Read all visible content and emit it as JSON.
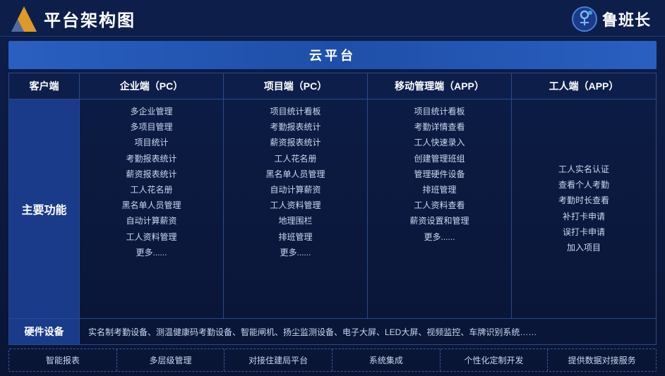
{
  "header": {
    "title": "平台架构图",
    "logo_name": "鲁班长"
  },
  "cloud_platform": "云平台",
  "columns": {
    "client": "客户端",
    "enterprise": "企业端（PC）",
    "project_pc": "项目端（PC）",
    "mobile_mgmt": "移动管理端（APP）",
    "worker": "工人端（APP）"
  },
  "main_function_label": "主要功能",
  "enterprise_items": [
    "多企业管理",
    "多项目管理",
    "项目统计",
    "考勤报表统计",
    "薪资报表统计",
    "工人花名册",
    "黑名单人员管理",
    "自动计算薪资",
    "工人资料管理",
    "更多......"
  ],
  "project_pc_items": [
    "项目统计看板",
    "考勤报表统计",
    "薪资报表统计",
    "工人花名册",
    "黑名单人员管理",
    "自动计算薪资",
    "工人资料管理",
    "地理围栏",
    "排班管理",
    "更多......"
  ],
  "mobile_mgmt_items": [
    "项目统计看板",
    "考勤详情查看",
    "工人快速录入",
    "创建管理班组",
    "管理硬件设备",
    "排班管理",
    "工人资料查看",
    "薪资设置和管理",
    "更多......"
  ],
  "worker_items": [
    "工人实名认证",
    "查看个人考勤",
    "考勤时长查看",
    "补打卡申请",
    "误打卡申请",
    "加入项目"
  ],
  "hardware_label": "硬件设备",
  "hardware_content": "实名制考勤设备、测温健康码考勤设备、智能闸机、扬尘监测设备、电子大屏、LED大屏、视频监控、车牌识别系统……",
  "bottom_features": [
    "智能报表",
    "多层级管理",
    "对接住建局平台",
    "系统集成",
    "个性化定制开发",
    "提供数据对接服务"
  ]
}
